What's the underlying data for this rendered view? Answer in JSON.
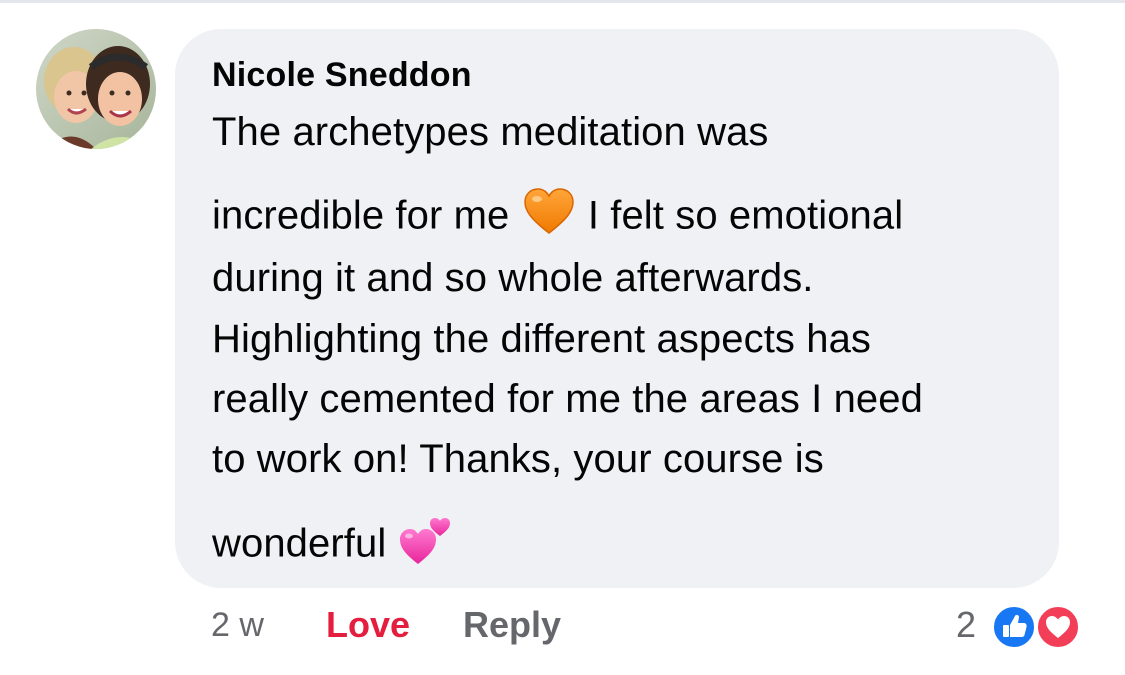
{
  "comment": {
    "author": "Nicole Sneddon",
    "lines": [
      {
        "before": "The archetypes meditation was"
      },
      {
        "before": "incredible for me ",
        "emoji": "orange-heart-icon",
        "after": " I felt so emotional"
      },
      {
        "before": "during it and so whole afterwards."
      },
      {
        "before": "Highlighting the different aspects has"
      },
      {
        "before": "really cemented for me the areas I need"
      },
      {
        "before": "to work on! Thanks, your course is"
      },
      {
        "before": "wonderful ",
        "emoji": "two-hearts-icon"
      }
    ]
  },
  "footer": {
    "time": "2 w",
    "love_label": "Love",
    "reply_label": "Reply",
    "reaction_count": "2",
    "reactions": [
      "like-icon",
      "heart-icon"
    ]
  },
  "colors": {
    "bubble": "#f0f1f5",
    "love": "#e41e3f",
    "meta": "#65676b",
    "like": "#1877f2",
    "heart": "#f33e58"
  }
}
